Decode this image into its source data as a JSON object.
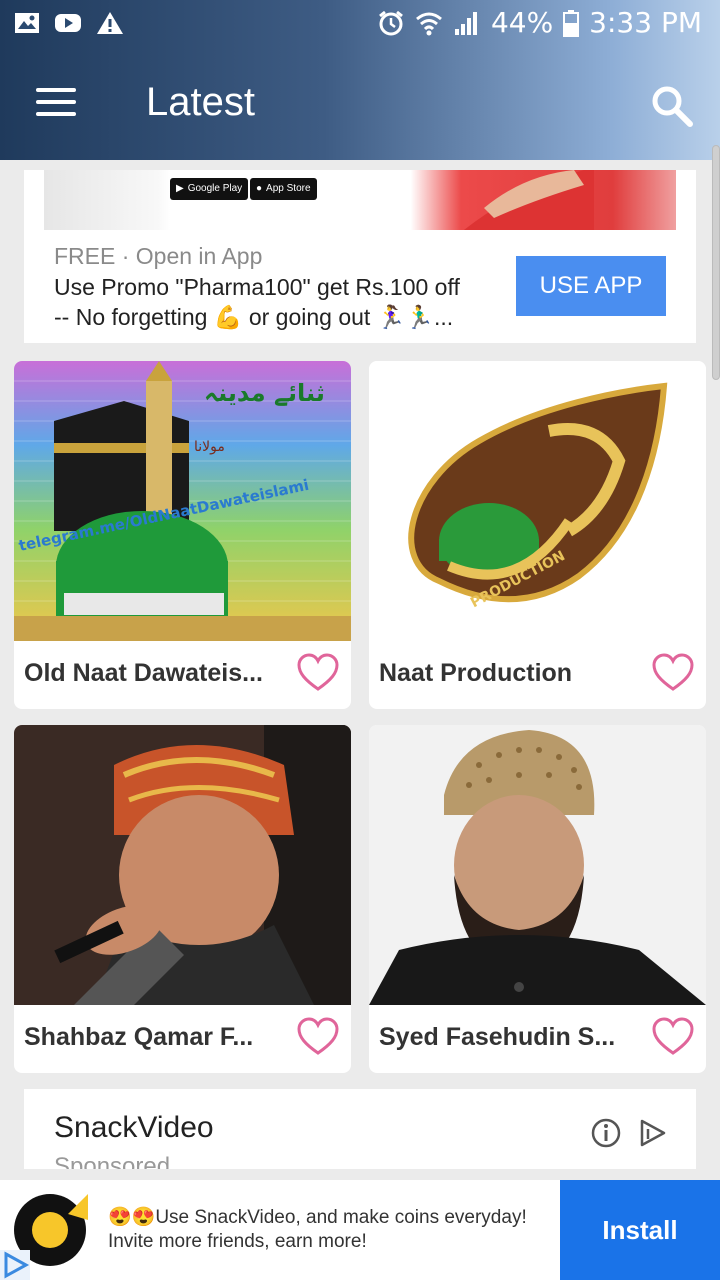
{
  "status_bar": {
    "battery": "44%",
    "time": "3:33 PM",
    "left_icons": [
      "image-icon",
      "youtube-icon",
      "warning-icon"
    ],
    "right_icons": [
      "alarm-icon",
      "wifi-icon",
      "signal-icon",
      "battery-icon"
    ]
  },
  "appbar": {
    "title": "Latest",
    "menu_icon": "menu-icon",
    "search_icon": "search-icon"
  },
  "promo_ad": {
    "badge_google": "Google Play",
    "badge_apple": "App Store",
    "free_label": "FREE · Open in App",
    "line1": "Use Promo \"Pharma100\" get Rs.100 off",
    "line2": "-- No forgetting 💪 or going out 🏃‍♀️🏃‍♂️...",
    "button": "USE APP",
    "button_color": "#4a8ef0"
  },
  "items": [
    {
      "title": "Old Naat Dawateis...",
      "image_caption": "telegram.me/OldNaatDawateislami",
      "favorite": false
    },
    {
      "title": "Naat Production",
      "image_caption": "PRODUCTION",
      "favorite": false
    },
    {
      "title": "Shahbaz Qamar F...",
      "favorite": false
    },
    {
      "title": "Syed Fasehudin S...",
      "favorite": false
    }
  ],
  "snack_ad": {
    "title": "SnackVideo",
    "sponsored": "Sponsored"
  },
  "bottom_ad": {
    "line1": "😍😍Use SnackVideo, and make coins everyday!",
    "line2": "Invite more friends, earn more!",
    "install": "Install",
    "install_color": "#1a73e8"
  },
  "colors": {
    "heart": "#e0659a",
    "appbar_start": "#1f3a5c",
    "appbar_end": "#b9d0ea"
  }
}
